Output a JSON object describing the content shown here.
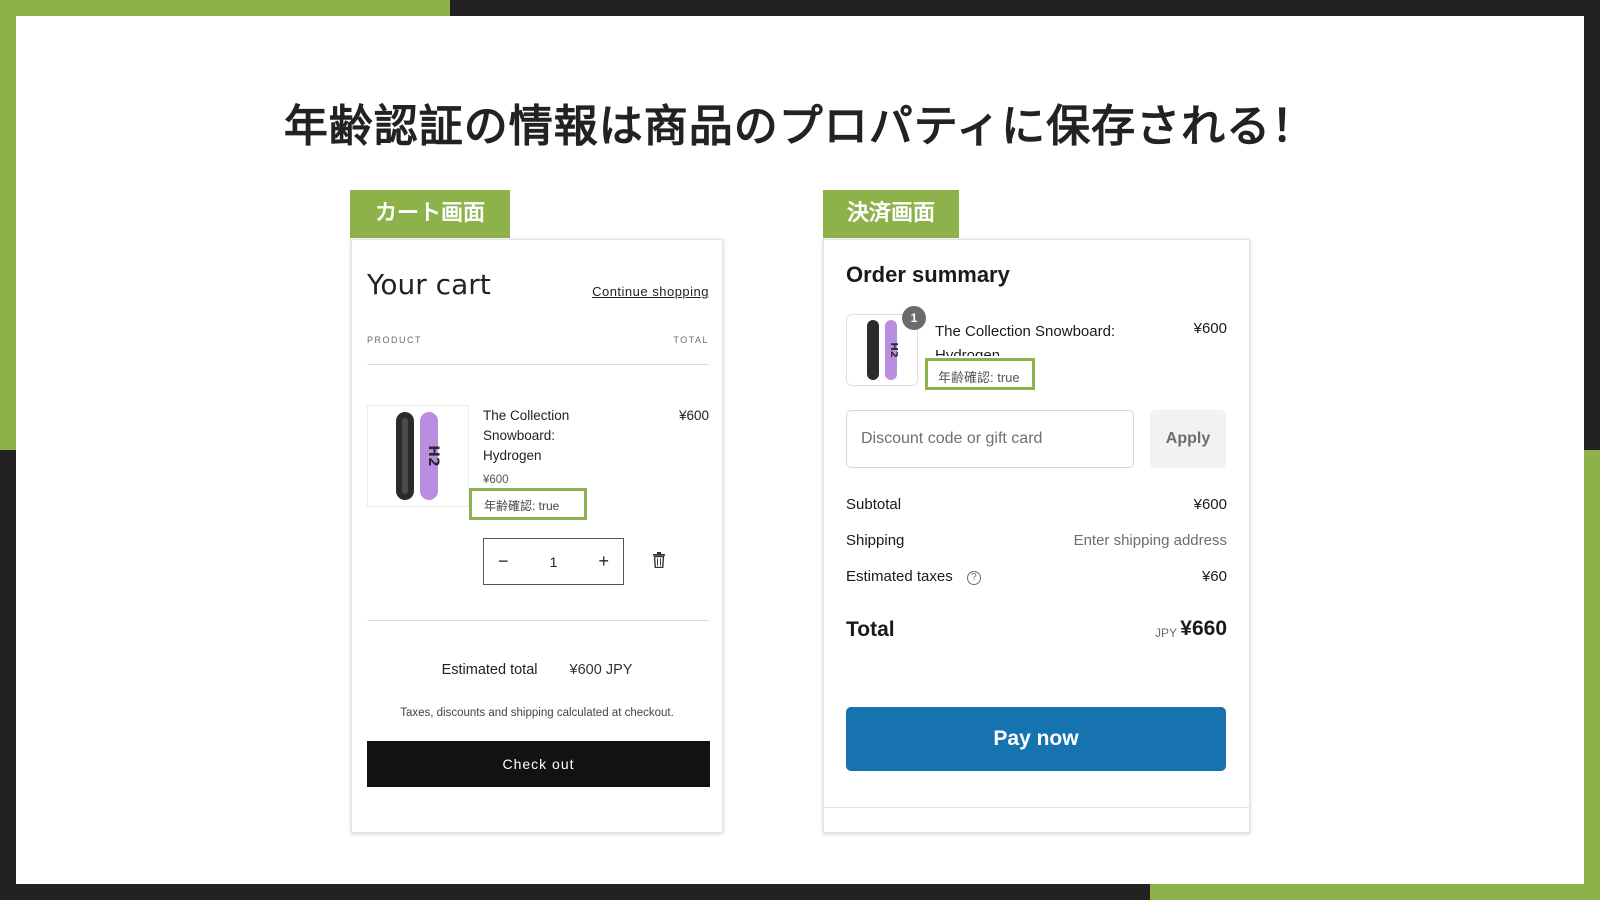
{
  "slide": {
    "title": "年齢認証の情報は商品のプロパティに保存される！",
    "colors": {
      "accent_green": "#8db24a",
      "frame_dark": "#222222",
      "pay_blue": "#1773b0"
    }
  },
  "cart": {
    "tab_label": "カート画面",
    "title": "Your cart",
    "continue_link": "Continue shopping",
    "col_product": "PRODUCT",
    "col_total": "TOTAL",
    "item": {
      "name": "The Collection Snowboard: Hydrogen",
      "price_small": "¥600",
      "price_total": "¥600",
      "property": "年齢確認: true",
      "quantity": "1",
      "minus_symbol": "−",
      "plus_symbol": "+"
    },
    "estimated_total_label": "Estimated total",
    "estimated_total_value": "¥600 JPY",
    "tax_note": "Taxes, discounts and shipping calculated at checkout.",
    "checkout_button": "Check out"
  },
  "checkout": {
    "tab_label": "決済画面",
    "title": "Order summary",
    "item": {
      "badge": "1",
      "name": "The Collection Snowboard: Hydrogen",
      "price": "¥600",
      "property": "年齢確認: true"
    },
    "discount_placeholder": "Discount code or gift card",
    "apply_button": "Apply",
    "subtotal_label": "Subtotal",
    "subtotal_value": "¥600",
    "shipping_label": "Shipping",
    "shipping_value": "Enter shipping address",
    "taxes_label": "Estimated taxes",
    "taxes_info_symbol": "?",
    "taxes_value": "¥60",
    "total_label": "Total",
    "total_currency": "JPY",
    "total_value": "¥660",
    "pay_button": "Pay now"
  }
}
